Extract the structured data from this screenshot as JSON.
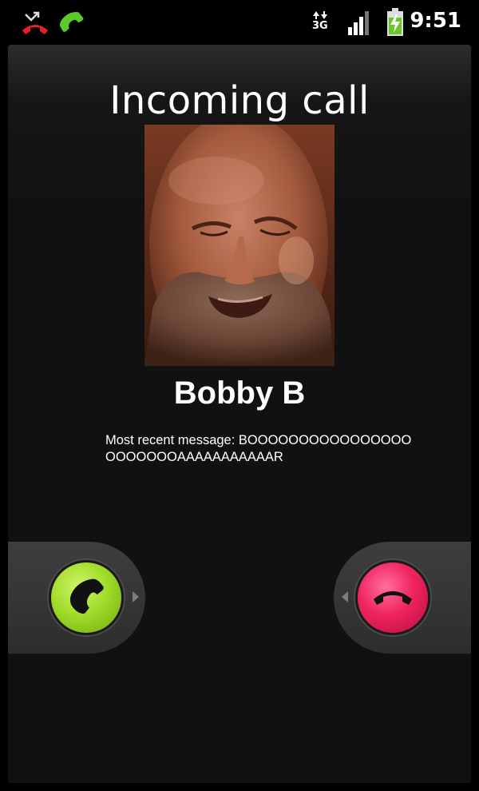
{
  "status_bar": {
    "time": "9:51",
    "network_type": "3G",
    "icons": [
      "missed-call-icon",
      "active-call-icon",
      "data-icon",
      "signal-icon",
      "battery-charging-icon"
    ]
  },
  "call": {
    "title": "Incoming call",
    "caller_name": "Bobby B",
    "message_label": "Most recent message:",
    "message_text": "BOOOOOOOOOOOOOOOOOOOOOOOAAAAAAAAAAAR"
  },
  "controls": {
    "answer_icon": "phone-answer-icon",
    "decline_icon": "phone-hangup-icon"
  },
  "colors": {
    "answer": "#a2dc2a",
    "decline": "#f0245f",
    "background": "#111111"
  }
}
